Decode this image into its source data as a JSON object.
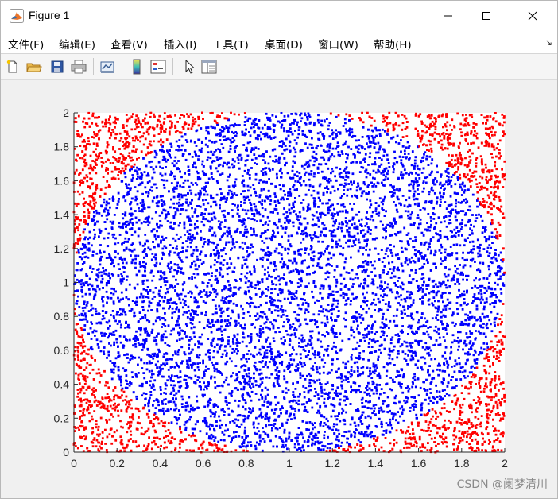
{
  "window": {
    "title": "Figure 1",
    "controls": {
      "minimize": "minimize",
      "maximize": "maximize",
      "close": "close"
    }
  },
  "menu": {
    "items": [
      {
        "label": "文件(F)"
      },
      {
        "label": "编辑(E)"
      },
      {
        "label": "查看(V)"
      },
      {
        "label": "插入(I)"
      },
      {
        "label": "工具(T)"
      },
      {
        "label": "桌面(D)"
      },
      {
        "label": "窗口(W)"
      },
      {
        "label": "帮助(H)"
      }
    ],
    "overflow_glyph": "↘"
  },
  "toolbar": {
    "buttons": [
      {
        "icon": "new-file-icon"
      },
      {
        "icon": "open-folder-icon"
      },
      {
        "icon": "save-icon"
      },
      {
        "icon": "print-icon"
      },
      {
        "icon": "link-plot-icon"
      },
      {
        "icon": "colorbar-icon"
      },
      {
        "icon": "legend-icon"
      },
      {
        "icon": "pointer-icon"
      },
      {
        "icon": "property-editor-icon"
      }
    ]
  },
  "watermark": "CSDN @阑梦清川",
  "colors": {
    "inside": "#0000ff",
    "outside": "#ff0000",
    "axes_bg": "#ffffff",
    "figure_bg": "#f0f0f0"
  },
  "chart_data": {
    "type": "scatter",
    "title": "",
    "xlabel": "",
    "ylabel": "",
    "xlim": [
      0,
      2
    ],
    "ylim": [
      0,
      2
    ],
    "x_ticks": [
      "0",
      "0.2",
      "0.4",
      "0.6",
      "0.8",
      "1",
      "1.2",
      "1.4",
      "1.6",
      "1.8",
      "2"
    ],
    "y_ticks": [
      "0",
      "0.2",
      "0.4",
      "0.6",
      "0.8",
      "1",
      "1.2",
      "1.4",
      "1.6",
      "1.8",
      "2"
    ],
    "grid": false,
    "legend": "none",
    "series": [
      {
        "color": "#0000ff",
        "marker": "point",
        "region": "(x-1)^2 + (y-1)^2 <= 1",
        "distribution": "uniform random",
        "approx_points": 7850
      },
      {
        "color": "#ff0000",
        "marker": "point",
        "region": "(x-1)^2 + (y-1)^2 > 1",
        "distribution": "uniform random",
        "approx_points": 2150
      }
    ]
  }
}
